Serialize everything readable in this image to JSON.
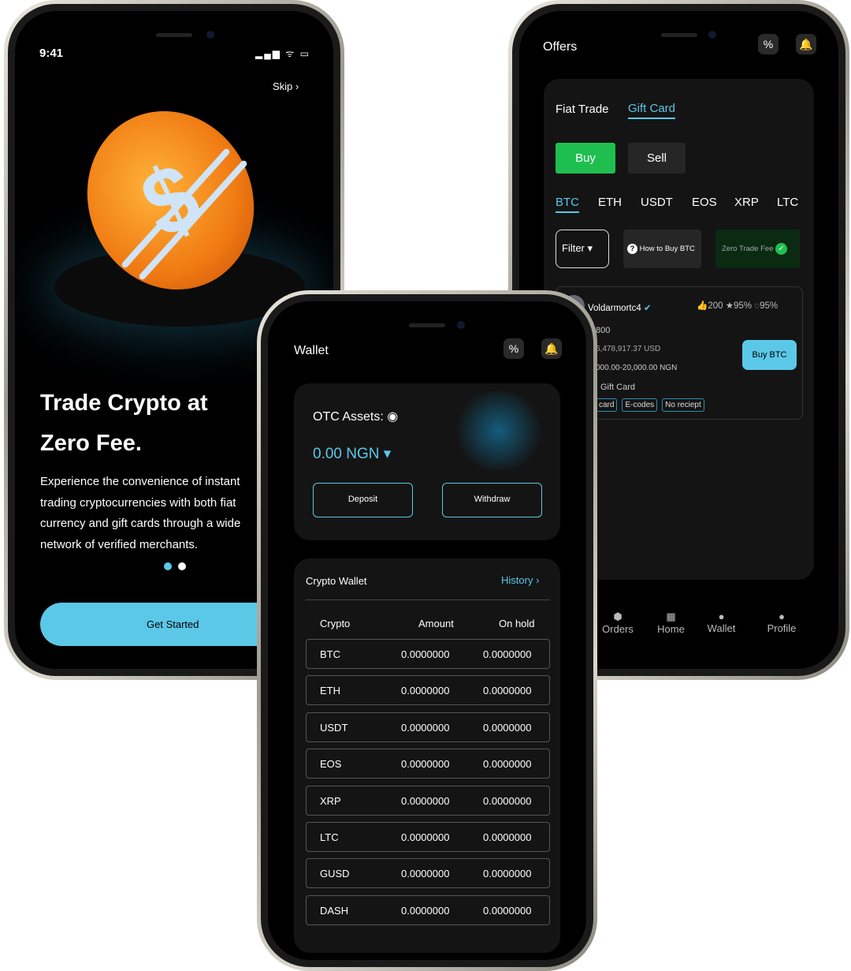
{
  "onboarding": {
    "time": "9:41",
    "skip": "Skip",
    "title_line1": "Trade Crypto at",
    "title_line2": "Zero Fee.",
    "body_lines": [
      "Experience the convenience of instant",
      "trading cryptocurrencies with both fiat",
      "currency and gift cards through a wide",
      "network of verified merchants."
    ],
    "cta": "Get Started",
    "active_dot": 1,
    "dot_count": 2
  },
  "offers": {
    "title": "Offers",
    "tabs": [
      "Fiat Trade",
      "Gift Card"
    ],
    "active_tab": "Gift Card",
    "buy": "Buy",
    "sell": "Sell",
    "coins": [
      "BTC",
      "ETH",
      "USDT",
      "EOS",
      "XRP",
      "LTC"
    ],
    "active_coin": "BTC",
    "filter": "Filter",
    "how_to": "How to Buy BTC",
    "zero_fee": "Zero Trade Fee",
    "merchant": {
      "name": "Voldarmortc4",
      "likes": "200",
      "rating": "95%",
      "completion": "95%",
      "line1": "800",
      "line2": "6,478,917.37 USD",
      "line3": "000.00-20,000.00 NGN",
      "type": "Gift Card",
      "tags": [
        "card",
        "E-codes",
        "No reciept"
      ],
      "action": "Buy BTC"
    },
    "nav": [
      "Orders",
      "Home",
      "Wallet",
      "Profile"
    ]
  },
  "wallet": {
    "title": "Wallet",
    "assets_label": "OTC Assets:",
    "balance": "0.00 NGN",
    "deposit": "Deposit",
    "withdraw": "Withdraw",
    "crypto_wallet": "Crypto Wallet",
    "history": "History",
    "columns": [
      "Crypto",
      "Amount",
      "On hold"
    ],
    "rows": [
      [
        "BTC",
        "0.0000000",
        "0.0000000"
      ],
      [
        "ETH",
        "0.0000000",
        "0.0000000"
      ],
      [
        "USDT",
        "0.0000000",
        "0.0000000"
      ],
      [
        "EOS",
        "0.0000000",
        "0.0000000"
      ],
      [
        "XRP",
        "0.0000000",
        "0.0000000"
      ],
      [
        "LTC",
        "0.0000000",
        "0.0000000"
      ],
      [
        "GUSD",
        "0.0000000",
        "0.0000000"
      ],
      [
        "DASH",
        "0.0000000",
        "0.0000000"
      ]
    ]
  },
  "colors": {
    "accent": "#5bc8e8",
    "buy_green": "#1fbf4f",
    "panel": "#141414"
  }
}
